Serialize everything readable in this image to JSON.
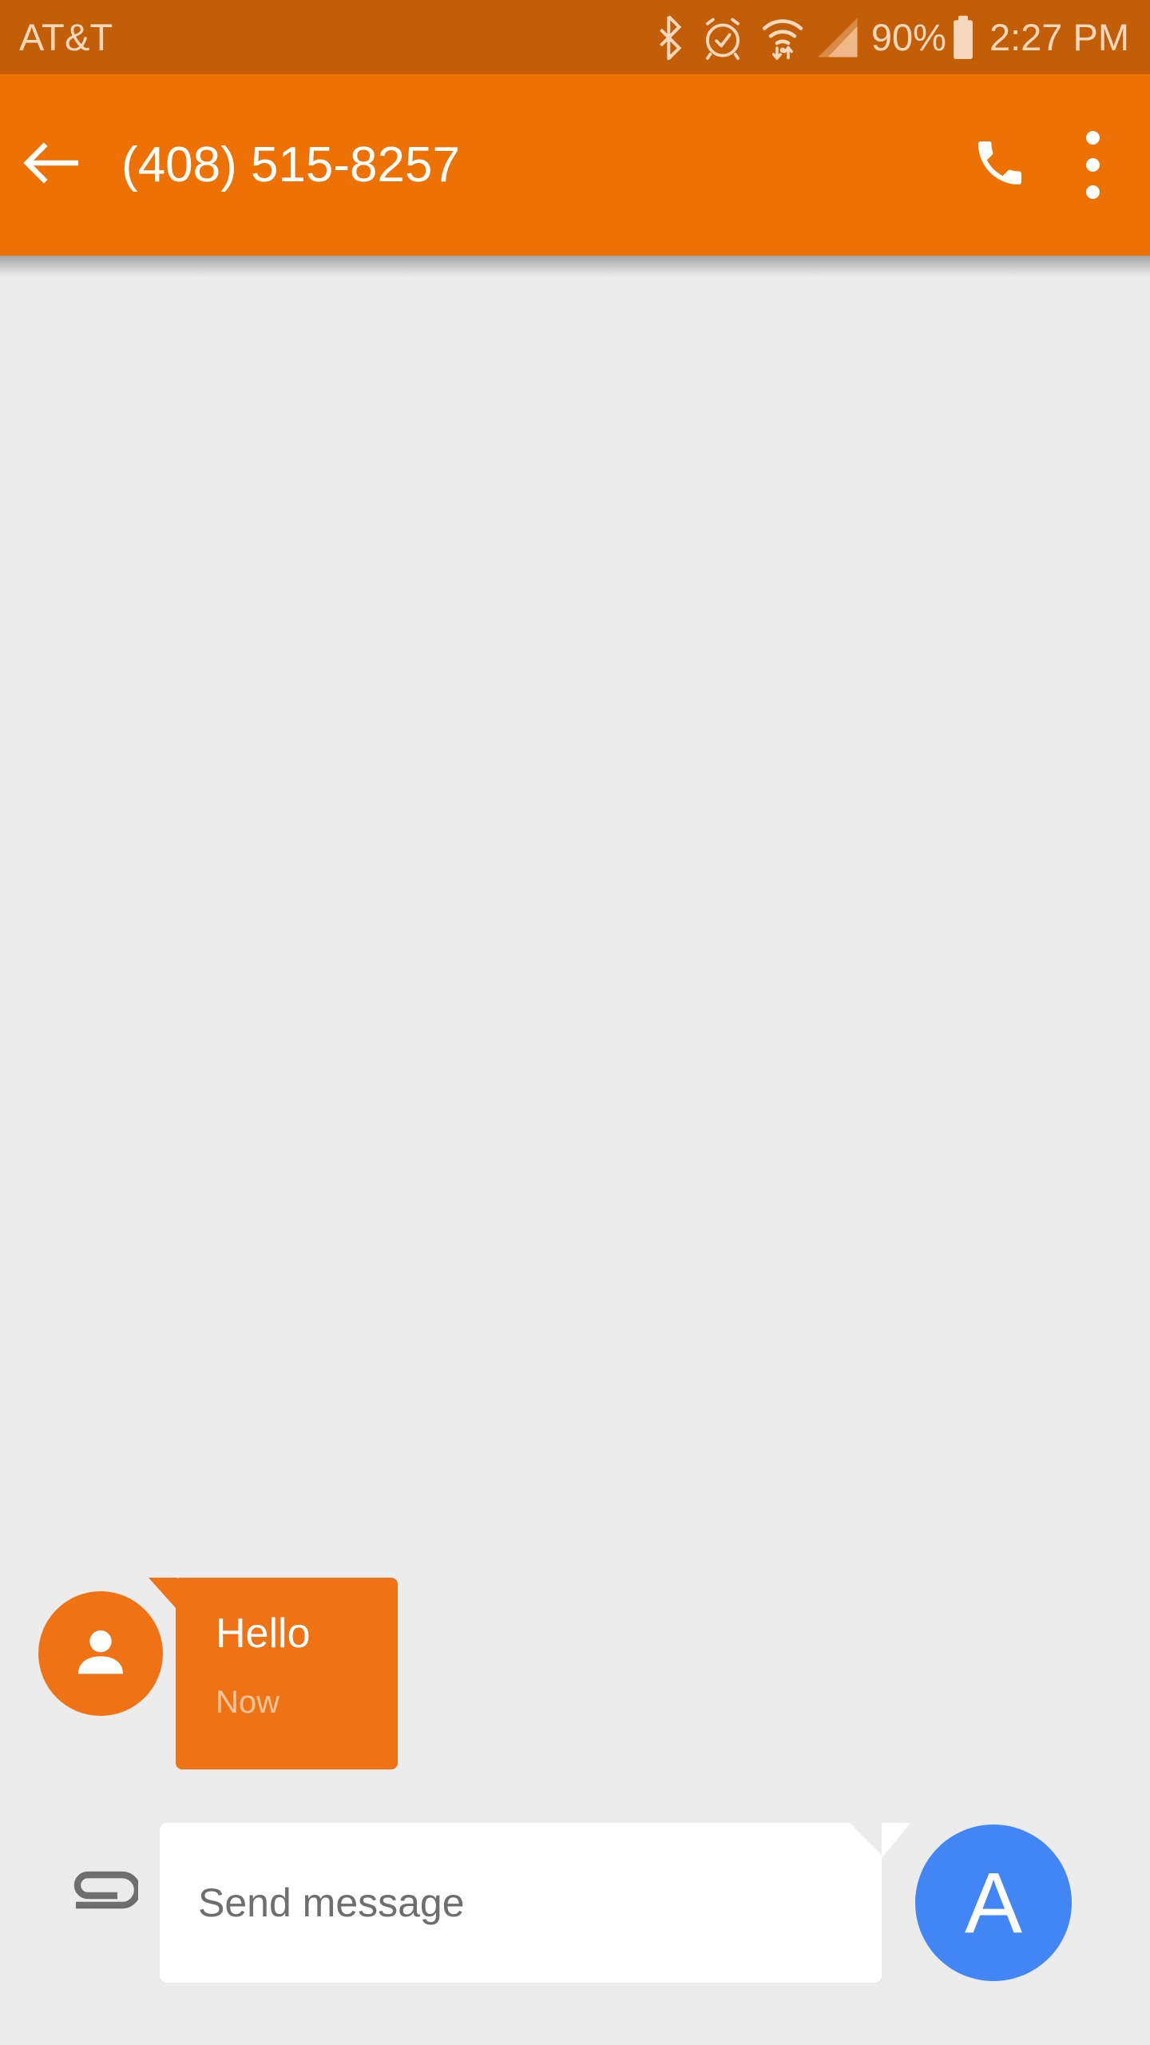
{
  "status_bar": {
    "carrier": "AT&T",
    "battery_percent": "90%",
    "clock": "2:27 PM",
    "icons": [
      "bluetooth-icon",
      "alarm-clock-icon",
      "wifi-icon",
      "cellular-signal-icon",
      "battery-icon"
    ],
    "background_color": "#C25E08",
    "text_color": "#F6D8BD"
  },
  "app_bar": {
    "back_label": "back-arrow",
    "title": "(408) 515-8257",
    "call_label": "call",
    "overflow_label": "more options",
    "background_color": "#EE7203",
    "text_color": "#FFFFFF"
  },
  "thread": {
    "background_color": "#ECECEC",
    "messages": [
      {
        "sender": "contact",
        "avatar_icon": "person-icon",
        "avatar_color": "#EF7215",
        "text": "Hello",
        "timestamp": "Now",
        "bubble_color": "#EF7215",
        "text_color": "#FFFFFF",
        "timestamp_color": "#F9C59C"
      }
    ]
  },
  "composer": {
    "attach_icon": "paperclip-icon",
    "input_value": "",
    "input_placeholder": "Send message",
    "placeholder_color": "#6E6E6E",
    "send_letter": "A",
    "send_color": "#4285F4",
    "input_background": "#FFFFFF"
  }
}
